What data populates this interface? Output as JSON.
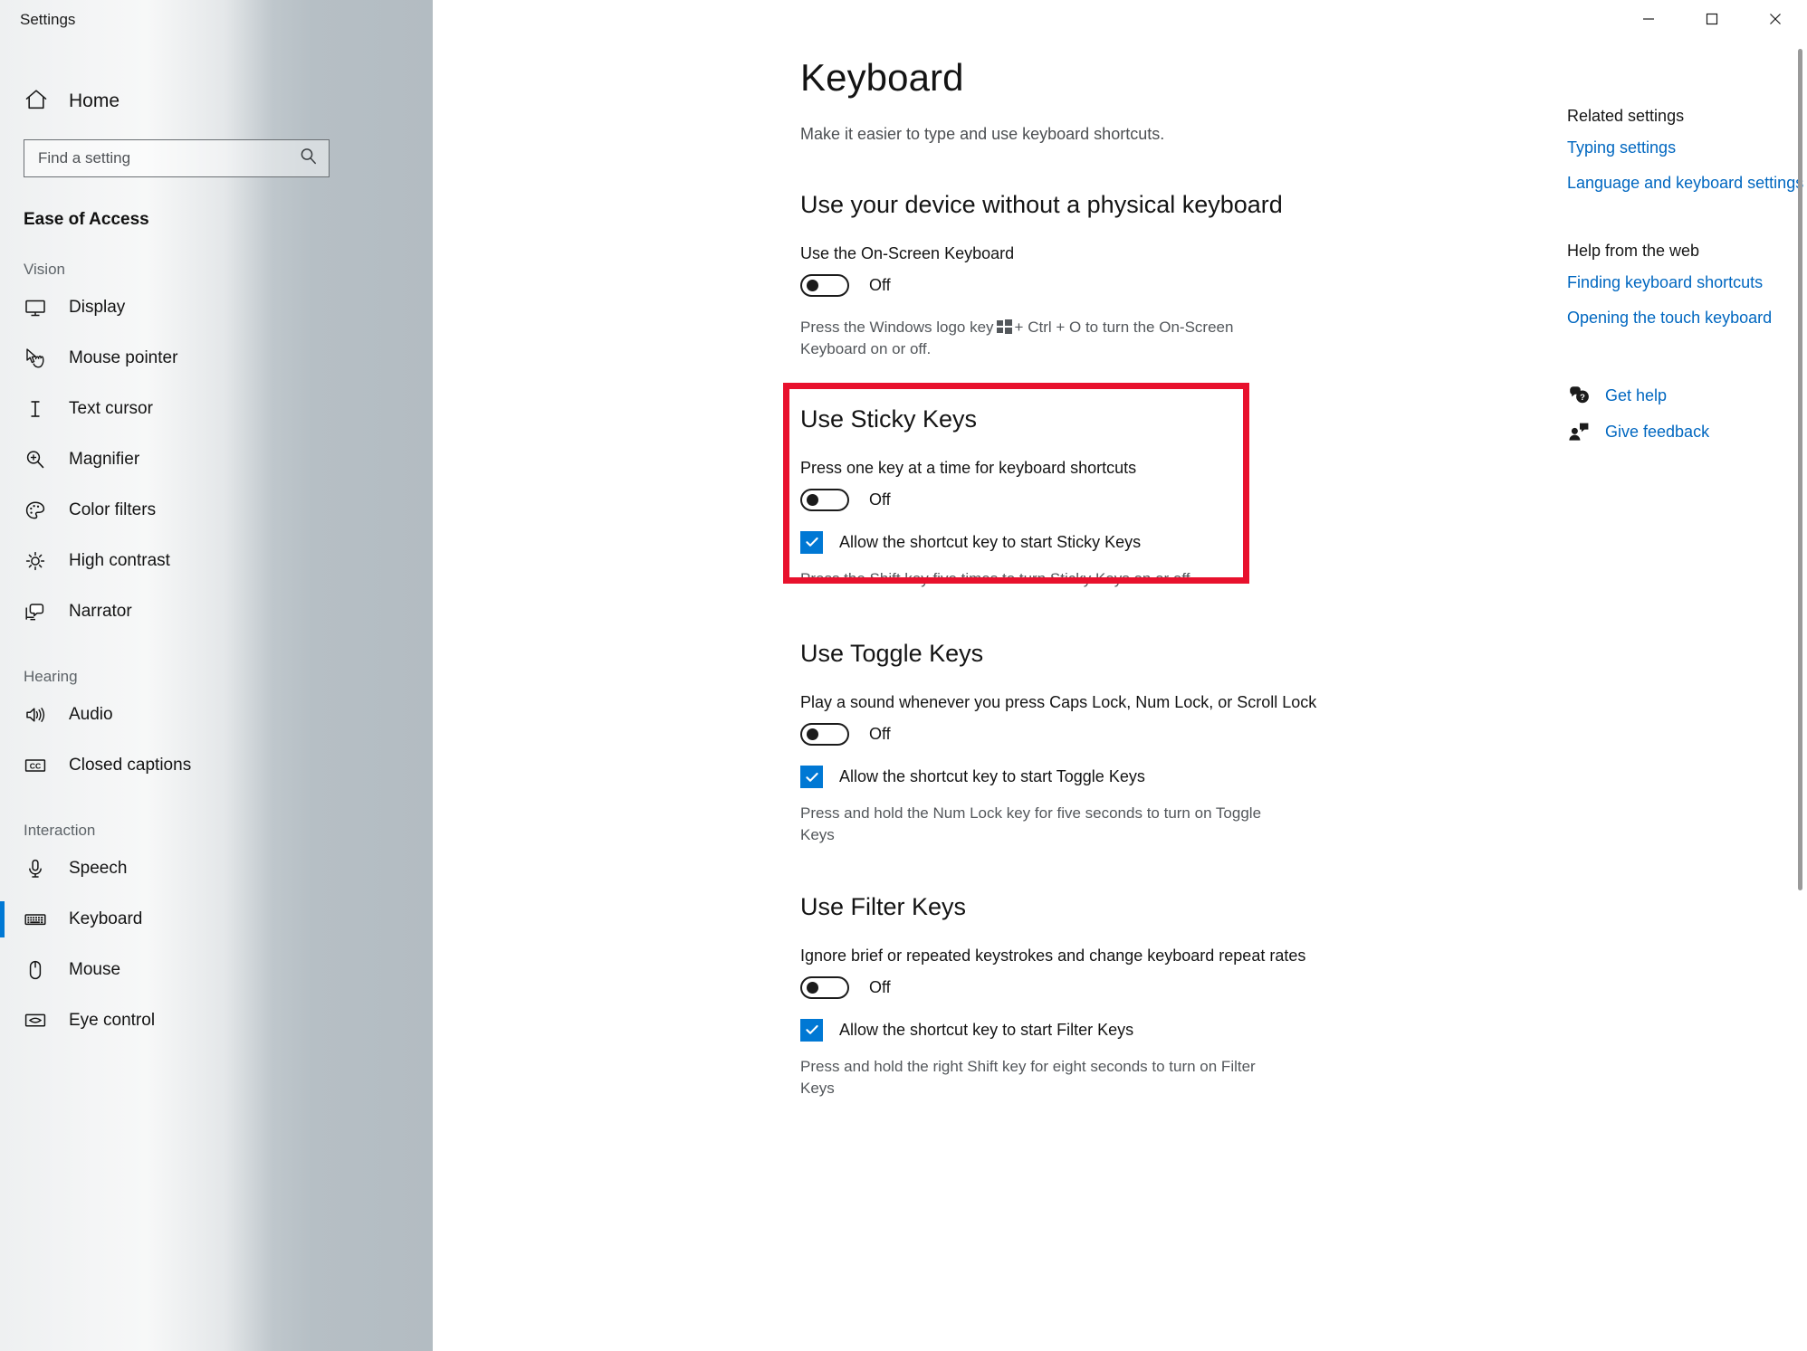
{
  "window": {
    "title": "Settings",
    "minimize_label": "Minimize",
    "maximize_label": "Maximize",
    "close_label": "Close"
  },
  "sidebar": {
    "home_label": "Home",
    "search": {
      "placeholder": "Find a setting",
      "value": ""
    },
    "category": "Ease of Access",
    "groups": [
      {
        "title": "Vision",
        "items": [
          {
            "label": "Display",
            "icon": "monitor-icon",
            "selected": false
          },
          {
            "label": "Mouse pointer",
            "icon": "mouse-pointer-icon",
            "selected": false
          },
          {
            "label": "Text cursor",
            "icon": "text-cursor-icon",
            "selected": false
          },
          {
            "label": "Magnifier",
            "icon": "magnifier-icon",
            "selected": false
          },
          {
            "label": "Color filters",
            "icon": "palette-icon",
            "selected": false
          },
          {
            "label": "High contrast",
            "icon": "brightness-icon",
            "selected": false
          },
          {
            "label": "Narrator",
            "icon": "narrator-icon",
            "selected": false
          }
        ]
      },
      {
        "title": "Hearing",
        "items": [
          {
            "label": "Audio",
            "icon": "speaker-icon",
            "selected": false
          },
          {
            "label": "Closed captions",
            "icon": "closed-caption-icon",
            "selected": false
          }
        ]
      },
      {
        "title": "Interaction",
        "items": [
          {
            "label": "Speech",
            "icon": "microphone-icon",
            "selected": false
          },
          {
            "label": "Keyboard",
            "icon": "keyboard-icon",
            "selected": true
          },
          {
            "label": "Mouse",
            "icon": "mouse-icon",
            "selected": false
          },
          {
            "label": "Eye control",
            "icon": "eye-control-icon",
            "selected": false
          }
        ]
      }
    ]
  },
  "main": {
    "title": "Keyboard",
    "subtitle": "Make it easier to type and use keyboard shortcuts.",
    "sections": [
      {
        "id": "on-screen-keyboard",
        "heading": "Use your device without a physical keyboard",
        "setting_label": "Use the On-Screen Keyboard",
        "toggle_state": "Off",
        "toggle_on": false,
        "description_before": "Press the Windows logo key",
        "description_after": "+ Ctrl + O to turn the On-Screen Keyboard on or off."
      },
      {
        "id": "sticky-keys",
        "heading": "Use Sticky Keys",
        "setting_label": "Press one key at a time for keyboard shortcuts",
        "toggle_state": "Off",
        "toggle_on": false,
        "checkbox_label": "Allow the shortcut key to start Sticky Keys",
        "checkbox_checked": true,
        "description": "Press the Shift key five times to turn Sticky Keys on or off",
        "highlighted": true
      },
      {
        "id": "toggle-keys",
        "heading": "Use Toggle Keys",
        "setting_label": "Play a sound whenever you press Caps Lock, Num Lock, or Scroll Lock",
        "toggle_state": "Off",
        "toggle_on": false,
        "checkbox_label": "Allow the shortcut key to start Toggle Keys",
        "checkbox_checked": true,
        "description": "Press and hold the Num Lock key for five seconds to turn on Toggle Keys"
      },
      {
        "id": "filter-keys",
        "heading": "Use Filter Keys",
        "setting_label": "Ignore brief or repeated keystrokes and change keyboard repeat rates",
        "toggle_state": "Off",
        "toggle_on": false,
        "checkbox_label": "Allow the shortcut key to start Filter Keys",
        "checkbox_checked": true,
        "description": "Press and hold the right Shift key for eight seconds to turn on Filter Keys"
      }
    ]
  },
  "right_panel": {
    "related_heading": "Related settings",
    "related_links": [
      "Typing settings",
      "Language and keyboard settings"
    ],
    "help_heading": "Help from the web",
    "help_links": [
      "Finding keyboard shortcuts",
      "Opening the touch keyboard"
    ],
    "support_links": [
      {
        "label": "Get help",
        "icon": "get-help-icon"
      },
      {
        "label": "Give feedback",
        "icon": "give-feedback-icon"
      }
    ]
  },
  "colors": {
    "accent": "#0078d4",
    "link": "#0067c0",
    "annotation": "#e8112d"
  }
}
